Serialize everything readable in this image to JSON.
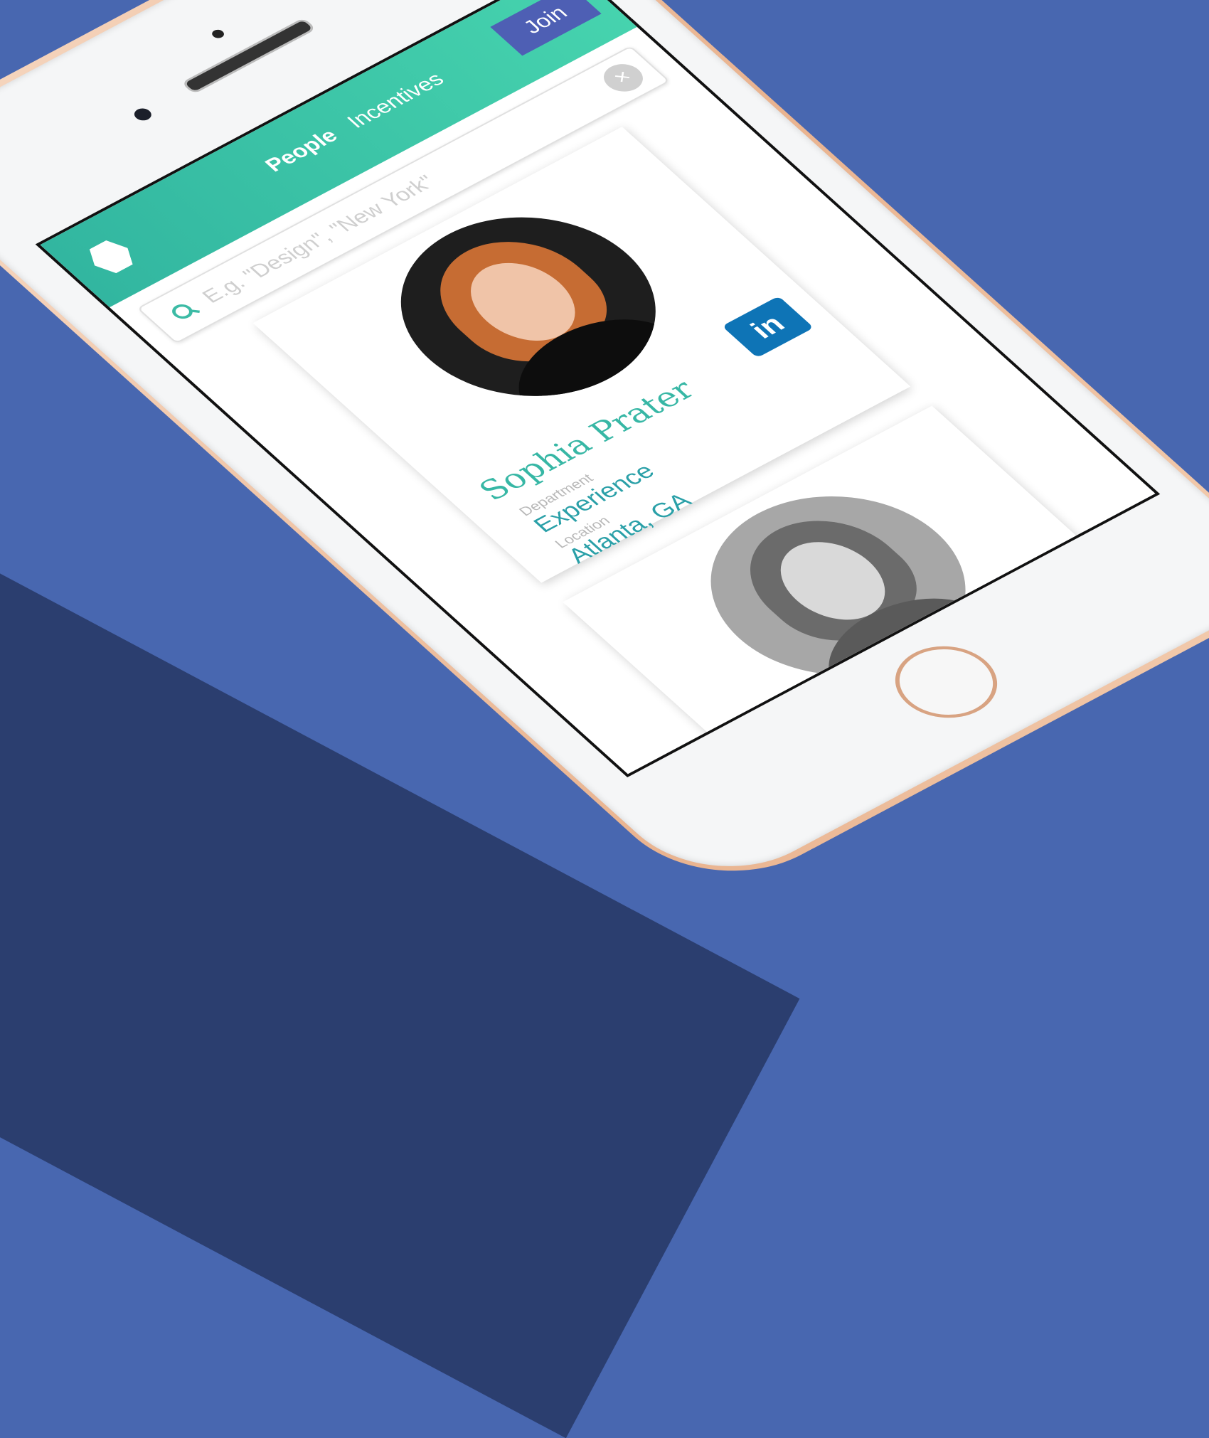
{
  "app": {
    "header": {
      "logo_icon": "hexagon-logo-icon",
      "tabs": [
        {
          "label": "People",
          "active": true
        },
        {
          "label": "Incentives",
          "active": false
        }
      ],
      "join_label": "Join",
      "accent_color": "#3cbba5"
    },
    "search": {
      "placeholder": "E.g. \"Design\", \"New York\"",
      "value": "",
      "clear_icon": "close-icon"
    },
    "profiles": [
      {
        "name": "Sophia Prater",
        "department_label": "Department",
        "department": "Experience",
        "location_label": "Location",
        "location": "Atlanta, GA",
        "linkedin_label": "in"
      }
    ]
  }
}
